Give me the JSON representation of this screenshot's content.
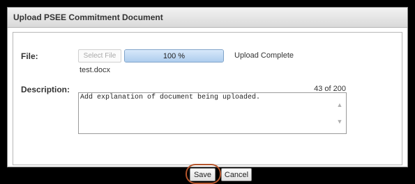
{
  "dialog": {
    "title": "Upload PSEE Commitment Document"
  },
  "file": {
    "label": "File:",
    "select_button": "Select File",
    "progress_text": "100 %",
    "progress_fraction": 1.0,
    "status": "Upload Complete",
    "filename": "test.docx"
  },
  "description": {
    "label": "Description:",
    "counter": "43 of 200",
    "value": "Add explanation of document being uploaded."
  },
  "actions": {
    "save_label": "Save",
    "cancel_label": "Cancel"
  },
  "colors": {
    "highlight": "#b4552c",
    "progress_border": "#7fa3c9"
  },
  "icons": {
    "scroll_up": "chevron-up-icon",
    "scroll_down": "chevron-down-icon"
  }
}
